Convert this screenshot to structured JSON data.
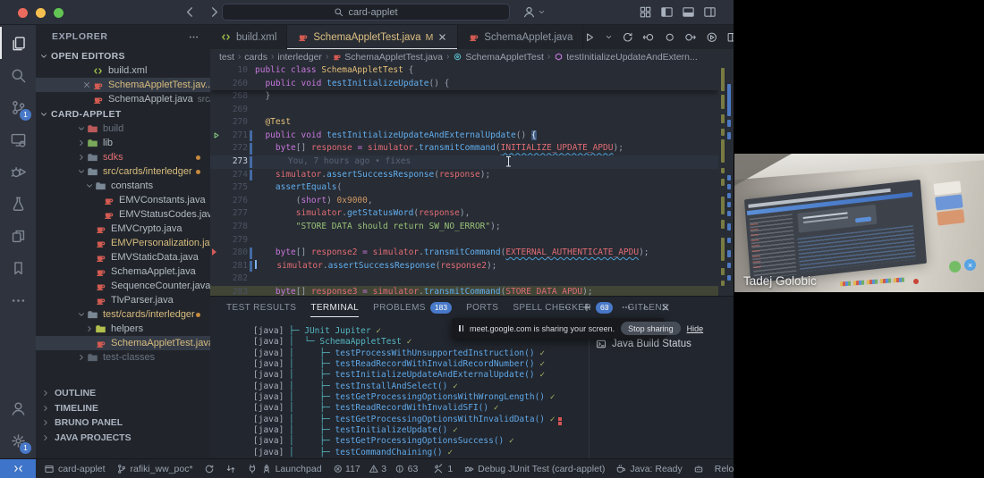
{
  "colors": {
    "accent_blue": "#4878c8",
    "remote_blue": "#3e74c9",
    "error_red": "#e06c75",
    "modified_yellow": "#e2c08d",
    "string_green": "#98c379",
    "keyword_purple": "#c678dd",
    "function_blue": "#61afef",
    "number_orange": "#d19a66",
    "class_yellow": "#e5c07b",
    "check_olive": "#a9b665",
    "tree_cyan": "#56b6c2",
    "java_red": "#d35b52",
    "xml_green": "#a6c84c"
  },
  "title_bar": {
    "search_value": "card-applet",
    "layout_icons": [
      "layout-grid",
      "panel-left",
      "panel-bottom",
      "panel-right"
    ]
  },
  "activity_bar": {
    "top": [
      {
        "id": "explorer",
        "icon": "files",
        "active": true
      },
      {
        "id": "search",
        "icon": "search"
      },
      {
        "id": "source-control",
        "icon": "source-control",
        "badge": "1"
      },
      {
        "id": "remote-explorer",
        "icon": "remote-explorer"
      },
      {
        "id": "run-and-debug",
        "icon": "debug"
      },
      {
        "id": "testing",
        "icon": "beaker"
      },
      {
        "id": "references",
        "icon": "refs"
      },
      {
        "id": "bookmarks",
        "icon": "bookmark"
      },
      {
        "id": "more",
        "icon": "more"
      }
    ],
    "bottom": [
      {
        "id": "accounts",
        "icon": "account"
      },
      {
        "id": "settings",
        "icon": "gear",
        "badge": "1"
      }
    ]
  },
  "explorer": {
    "title": "EXPLORER",
    "open_editors_label": "OPEN EDITORS",
    "open_editors": [
      {
        "label": "build.xml",
        "icon": "xml-file",
        "icon_color": "#a6c84c"
      },
      {
        "label": "SchemaAppletTest.jav...",
        "icon": "java-file",
        "icon_color": "#d35b52",
        "color": "mod",
        "badge": "M",
        "selected": true,
        "close": true
      },
      {
        "label": "SchemaApplet.java",
        "icon": "java-file",
        "icon_color": "#d35b52",
        "suffix": "src/card..."
      }
    ],
    "project_label": "CARD-APPLET",
    "tree": [
      {
        "indent": 0,
        "chevron": "down",
        "icon": "folder",
        "icon_color": "#bb5a5a",
        "label": "build",
        "color": "dim"
      },
      {
        "indent": 0,
        "chevron": "right",
        "icon": "folder",
        "icon_color": "#7aa85a",
        "label": "lib"
      },
      {
        "indent": 0,
        "chevron": "right",
        "icon": "folder",
        "icon_color": "#717d8a",
        "label": "sdks",
        "color": "err",
        "dot": true
      },
      {
        "indent": 0,
        "chevron": "down",
        "icon": "folder",
        "icon_color": "#7a8794",
        "label": "src/cards/interledger",
        "color": "mod",
        "dot": true
      },
      {
        "indent": 1,
        "chevron": "down",
        "icon": "folder",
        "icon_color": "#7a8794",
        "label": "constants"
      },
      {
        "indent": 2,
        "icon": "java-file",
        "icon_color": "#d35b52",
        "label": "EMVConstants.java"
      },
      {
        "indent": 2,
        "icon": "java-file",
        "icon_color": "#d35b52",
        "label": "EMVStatusCodes.java"
      },
      {
        "indent": 1,
        "icon": "java-file",
        "icon_color": "#d35b52",
        "label": "EMVCrypto.java"
      },
      {
        "indent": 1,
        "icon": "java-file",
        "icon_color": "#d35b52",
        "label": "EMVPersonalization.java",
        "color": "mod",
        "badge": "1"
      },
      {
        "indent": 1,
        "icon": "java-file",
        "icon_color": "#d35b52",
        "label": "EMVStaticData.java"
      },
      {
        "indent": 1,
        "icon": "java-file",
        "icon_color": "#d35b52",
        "label": "SchemaApplet.java"
      },
      {
        "indent": 1,
        "icon": "java-file",
        "icon_color": "#d35b52",
        "label": "SequenceCounter.java"
      },
      {
        "indent": 1,
        "icon": "java-file",
        "icon_color": "#d35b52",
        "label": "TlvParser.java"
      },
      {
        "indent": 0,
        "chevron": "down",
        "icon": "folder",
        "icon_color": "#7a8794",
        "label": "test/cards/interledger",
        "color": "mod",
        "dot": true
      },
      {
        "indent": 1,
        "chevron": "right",
        "icon": "folder",
        "icon_color": "#b3c04d",
        "label": "helpers"
      },
      {
        "indent": 1,
        "icon": "java-file",
        "icon_color": "#d35b52",
        "label": "SchemaAppletTest.java",
        "color": "mod",
        "badge": "M",
        "selected": true
      },
      {
        "indent": 0,
        "chevron": "right",
        "icon": "folder",
        "icon_color": "#5a6470",
        "label": "test-classes",
        "color": "dim"
      }
    ],
    "sections": [
      "OUTLINE",
      "TIMELINE",
      "BRUNO PANEL",
      "JAVA PROJECTS"
    ]
  },
  "editor": {
    "tabs": [
      {
        "label": "build.xml",
        "icon": "xml-file",
        "icon_color": "#a6c84c"
      },
      {
        "label": "SchemaAppletTest.java",
        "icon": "java-file",
        "icon_color": "#d35b52",
        "modified": "M",
        "active": true,
        "close": true
      },
      {
        "label": "SchemaApplet.java",
        "icon": "java-file",
        "icon_color": "#d35b52"
      }
    ],
    "actions": [
      "run",
      "chevron-down",
      "sync",
      "back-circle",
      "dot-circle",
      "forward-circle",
      "run-circle",
      "split",
      "more"
    ],
    "breadcrumb": [
      {
        "label": "test"
      },
      {
        "label": "cards"
      },
      {
        "label": "interledger"
      },
      {
        "label": "SchemaAppletTest.java",
        "icon": "java-file",
        "icon_color": "#d35b52"
      },
      {
        "label": "SchemaAppletTest",
        "icon": "class",
        "icon_color": "#56b6c2"
      },
      {
        "label": "testInitializeUpdateAndExtern...",
        "icon": "method",
        "icon_color": "#c678dd"
      }
    ],
    "blame_text": "You, 7 hours ago • fixes",
    "sticky": [
      {
        "num": "10",
        "tokens": [
          [
            "public class ",
            "kw"
          ],
          [
            "SchemaAppletTest ",
            "cls"
          ],
          [
            "{",
            "pun"
          ]
        ]
      },
      {
        "num": "260",
        "tokens": [
          [
            "  ",
            "pun"
          ],
          [
            "public void ",
            "kw"
          ],
          [
            "testInitializeUpdate",
            "fn"
          ],
          [
            "() {",
            "pun"
          ]
        ]
      }
    ],
    "lines": [
      {
        "num": "268",
        "tokens": [
          [
            "  }",
            "pun"
          ]
        ]
      },
      {
        "num": "269",
        "tokens": []
      },
      {
        "num": "270",
        "tokens": [
          [
            "  ",
            "pun"
          ],
          [
            "@Test",
            "ann"
          ]
        ]
      },
      {
        "num": "271",
        "play": true,
        "changed": true,
        "tokens": [
          [
            "  ",
            "pun"
          ],
          [
            "public void ",
            "kw"
          ],
          [
            "testInitializeUpdateAndExternalUpdate",
            "fn"
          ],
          [
            "() ",
            "pun"
          ],
          [
            "{",
            "brace"
          ]
        ]
      },
      {
        "num": "272",
        "changed": true,
        "tokens": [
          [
            "    ",
            "pun"
          ],
          [
            "byte",
            "kw"
          ],
          [
            "[] ",
            "pun"
          ],
          [
            "response",
            "var"
          ],
          [
            " = ",
            "op"
          ],
          [
            "simulator",
            "var"
          ],
          [
            ".",
            "pun"
          ],
          [
            "transmitCommand",
            "fn"
          ],
          [
            "(",
            "pun"
          ],
          [
            "INITIALIZE_UPDATE_APDU",
            "var sq"
          ],
          [
            ");",
            "pun"
          ]
        ]
      },
      {
        "num": "273",
        "current": true,
        "blame": true,
        "changed": true,
        "tokens": [
          [
            "    ",
            "pun"
          ]
        ]
      },
      {
        "num": "274",
        "changed": true,
        "tokens": [
          [
            "    ",
            "pun"
          ],
          [
            "simulator",
            "var"
          ],
          [
            ".",
            "pun"
          ],
          [
            "assertSuccessResponse",
            "fn"
          ],
          [
            "(",
            "pun"
          ],
          [
            "response",
            "var"
          ],
          [
            ");",
            "pun"
          ]
        ]
      },
      {
        "num": "275",
        "tokens": [
          [
            "    ",
            "pun"
          ],
          [
            "assertEquals",
            "fn"
          ],
          [
            "(",
            "pun"
          ]
        ]
      },
      {
        "num": "276",
        "tokens": [
          [
            "        (",
            "pun"
          ],
          [
            "short",
            "kw"
          ],
          [
            ") ",
            "pun"
          ],
          [
            "0x9000",
            "num"
          ],
          [
            ",",
            "pun"
          ]
        ]
      },
      {
        "num": "277",
        "tokens": [
          [
            "        ",
            "pun"
          ],
          [
            "simulator",
            "var"
          ],
          [
            ".",
            "pun"
          ],
          [
            "getStatusWord",
            "fn"
          ],
          [
            "(",
            "pun"
          ],
          [
            "response",
            "var"
          ],
          [
            "),",
            "pun"
          ]
        ]
      },
      {
        "num": "278",
        "tokens": [
          [
            "        ",
            "pun"
          ],
          [
            "\"STORE DATA should return SW_NO_ERROR\"",
            "str"
          ],
          [
            ");",
            "pun"
          ]
        ]
      },
      {
        "num": "279",
        "tokens": []
      },
      {
        "num": "280",
        "marker": true,
        "changed": true,
        "tokens": [
          [
            "    ",
            "pun"
          ],
          [
            "byte",
            "kw"
          ],
          [
            "[] ",
            "pun"
          ],
          [
            "response2",
            "var"
          ],
          [
            " = ",
            "op"
          ],
          [
            "simulator",
            "var"
          ],
          [
            ".",
            "pun"
          ],
          [
            "transmitCommand",
            "fn"
          ],
          [
            "(",
            "pun"
          ],
          [
            "EXTERNAL_AUTHENTICATE_APDU",
            "var sq"
          ],
          [
            ");",
            "pun"
          ]
        ]
      },
      {
        "num": "281",
        "caret": true,
        "changed": true,
        "tokens": [
          [
            "    ",
            "pun"
          ],
          [
            "simulator",
            "var"
          ],
          [
            ".",
            "pun"
          ],
          [
            "assertSuccessResponse",
            "fn"
          ],
          [
            "(",
            "pun"
          ],
          [
            "response2",
            "var"
          ],
          [
            ");",
            "pun"
          ]
        ]
      },
      {
        "num": "282",
        "tokens": []
      },
      {
        "num": "283",
        "match": true,
        "tokens": [
          [
            "    ",
            "pun"
          ],
          [
            "byte",
            "kw"
          ],
          [
            "[] ",
            "pun"
          ],
          [
            "response3",
            "var"
          ],
          [
            " = ",
            "op"
          ],
          [
            "simulator",
            "var"
          ],
          [
            ".",
            "pun"
          ],
          [
            "transmitCommand",
            "fn"
          ],
          [
            "(",
            "pun"
          ],
          [
            "STORE_DATA_APDU",
            "var"
          ],
          [
            ");",
            "pun"
          ]
        ]
      }
    ]
  },
  "panel": {
    "tabs": [
      {
        "label": "TEST RESULTS"
      },
      {
        "label": "TERMINAL",
        "active": true
      },
      {
        "label": "PROBLEMS",
        "badge": "183"
      },
      {
        "label": "PORTS"
      },
      {
        "label": "SPELL CHECKER",
        "badge": "63"
      },
      {
        "label": "GITLENS"
      }
    ],
    "actions": [
      "more",
      "plus",
      "chevron-down",
      "more",
      "chevron-up",
      "close"
    ],
    "terminal_prefix": "[java] ",
    "terminal_rows": [
      {
        "tree": "├─ ",
        "name": "JUnit Jupiter",
        "kind": "suite",
        "check": "✓"
      },
      {
        "tree": "│  └─ ",
        "name": "SchemaAppletTest",
        "kind": "suite",
        "check": "✓"
      },
      {
        "tree": "│     ├─ ",
        "name": "testProcessWithUnsupportedInstruction()",
        "check": "✓"
      },
      {
        "tree": "│     ├─ ",
        "name": "testReadRecordWithInvalidRecordNumber()",
        "check": "✓"
      },
      {
        "tree": "│     ├─ ",
        "name": "testInitializeUpdateAndExternalUpdate()",
        "check": "✓"
      },
      {
        "tree": "│     ├─ ",
        "name": "testInstallAndSelect()",
        "check": "✓"
      },
      {
        "tree": "│     ├─ ",
        "name": "testGetProcessingOptionsWithWrongLength()",
        "check": "✓"
      },
      {
        "tree": "│     ├─ ",
        "name": "testReadRecordWithInvalidSFI()",
        "check": "✓"
      },
      {
        "tree": "│     ├─ ",
        "name": "testGetProcessingOptionsWithInvalidData()",
        "check": "✓",
        "error": true
      },
      {
        "tree": "│     ├─ ",
        "name": "testInitializeUpdate()",
        "check": "✓"
      },
      {
        "tree": "│     ├─ ",
        "name": "testGetProcessingOptionsSuccess()",
        "check": "✓"
      },
      {
        "tree": "│     ├─ ",
        "name": "testCommandChaining()",
        "check": "✓"
      }
    ],
    "side_item": "Java Build Status"
  },
  "share_toast": {
    "message": "meet.google.com is sharing your screen.",
    "stop_label": "Stop sharing",
    "hide_label": "Hide"
  },
  "status_bar": {
    "items": [
      {
        "id": "remote",
        "icon": "remote",
        "style": "remote"
      },
      {
        "id": "workspace",
        "icon": "window",
        "label": "card-applet"
      },
      {
        "id": "branch",
        "icon": "branch",
        "label": "rafiki_ww_poc*"
      },
      {
        "id": "sync",
        "icon": "sync"
      },
      {
        "id": "compare",
        "icon": "compare"
      },
      {
        "id": "launchpad",
        "icon": "plug",
        "icon2": "rocket",
        "label": "Launchpad"
      },
      {
        "id": "problems",
        "group": [
          [
            "error",
            "117"
          ],
          [
            "warning",
            "3"
          ],
          [
            "info",
            "63"
          ]
        ]
      },
      {
        "id": "tasks",
        "icon": "tools",
        "label": "1"
      },
      {
        "id": "debug-session",
        "icon": "debug-alt",
        "label": "Debug JUnit Test (card-applet)"
      },
      {
        "id": "java-status",
        "icon": "coffee",
        "label": "Java: Ready"
      },
      {
        "id": "copilot",
        "icon": "robot"
      },
      {
        "id": "reload",
        "label": "Reload"
      },
      {
        "id": "do-not-disturb",
        "icon": "circle-slash"
      }
    ]
  },
  "video_call": {
    "participant_name": "Tadej Golobic"
  }
}
